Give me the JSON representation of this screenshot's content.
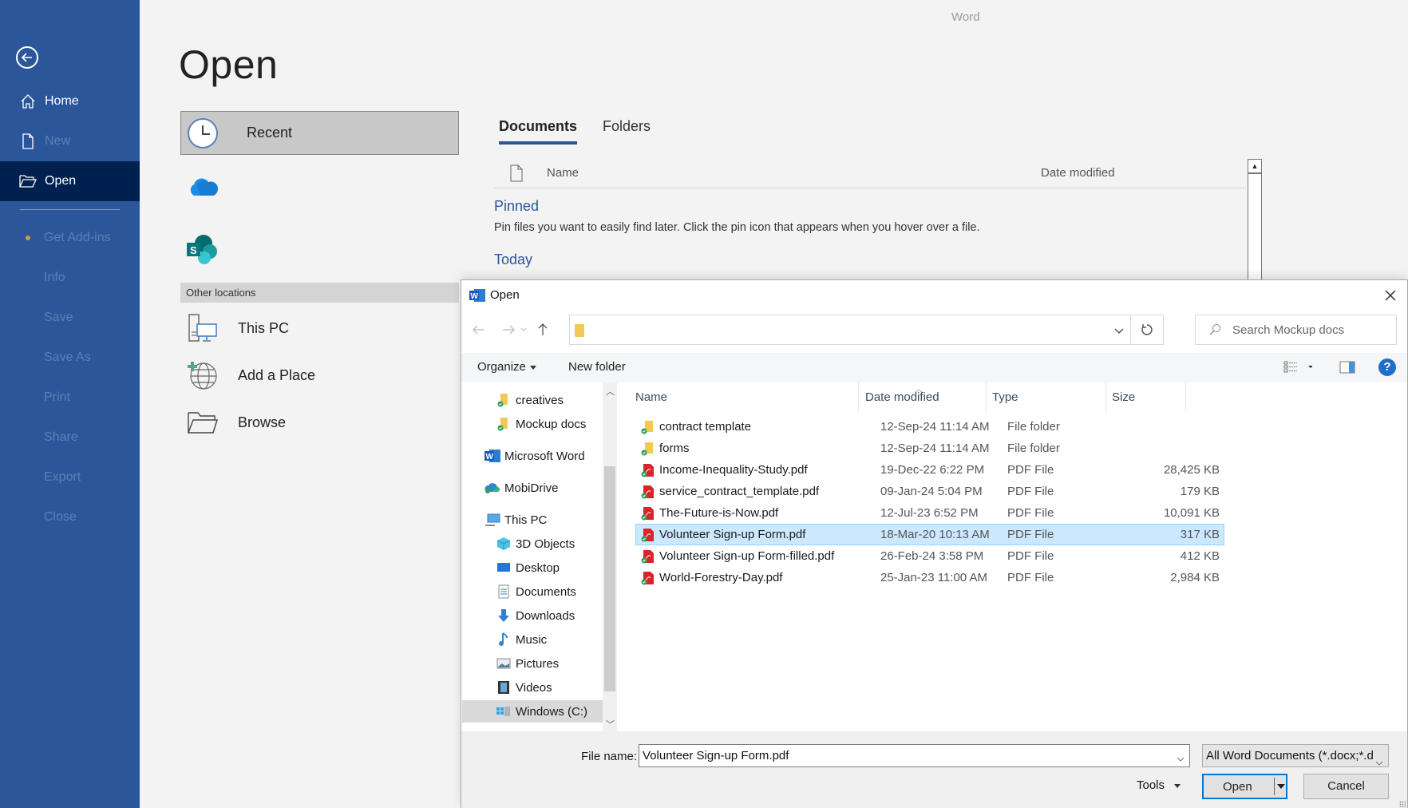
{
  "app": {
    "name": "Word"
  },
  "sidebar": {
    "back_label": "Back",
    "items": [
      {
        "label": "Home",
        "icon": "home-icon",
        "state": "normal"
      },
      {
        "label": "New",
        "icon": "new-document-icon",
        "state": "disabled"
      },
      {
        "label": "Open",
        "icon": "open-folder-icon",
        "state": "active"
      },
      {
        "label": "Get Add-ins",
        "state": "disabled"
      },
      {
        "label": "Info",
        "state": "disabled"
      },
      {
        "label": "Save",
        "state": "disabled"
      },
      {
        "label": "Save As",
        "state": "disabled"
      },
      {
        "label": "Print",
        "state": "disabled"
      },
      {
        "label": "Share",
        "state": "disabled"
      },
      {
        "label": "Export",
        "state": "disabled"
      },
      {
        "label": "Close",
        "state": "disabled"
      }
    ]
  },
  "backstage": {
    "title": "Open",
    "locations": {
      "recent_label": "Recent",
      "cloud_icon": "onedrive-icon",
      "sharepoint_icon": "sharepoint-icon",
      "other_header": "Other locations",
      "this_pc_label": "This PC",
      "add_place_label": "Add a Place",
      "browse_label": "Browse"
    },
    "tabs": [
      {
        "label": "Documents",
        "active": true
      },
      {
        "label": "Folders",
        "active": false
      }
    ],
    "columns": {
      "name": "Name",
      "date": "Date modified"
    },
    "pinned_title": "Pinned",
    "pinned_hint": "Pin files you want to easily find later. Click the pin icon that appears when you hover over a file.",
    "today_title": "Today"
  },
  "dialog": {
    "title": "Open",
    "address_path": "",
    "search_placeholder": "Search Mockup docs",
    "toolbar": {
      "organize_label": "Organize",
      "new_folder_label": "New folder"
    },
    "nav_tree": [
      {
        "label": "creatives",
        "icon": "folder-sync-icon",
        "indent": 2
      },
      {
        "label": "Mockup docs",
        "icon": "folder-sync-icon",
        "indent": 2
      },
      {
        "label": "Microsoft Word",
        "icon": "word-icon",
        "indent": 1
      },
      {
        "label": "MobiDrive",
        "icon": "cloud-drive-icon",
        "indent": 1
      },
      {
        "label": "This PC",
        "icon": "computer-icon",
        "indent": 1
      },
      {
        "label": "3D Objects",
        "icon": "cube-icon",
        "indent": 2
      },
      {
        "label": "Desktop",
        "icon": "desktop-icon",
        "indent": 2
      },
      {
        "label": "Documents",
        "icon": "documents-icon",
        "indent": 2
      },
      {
        "label": "Downloads",
        "icon": "download-icon",
        "indent": 2
      },
      {
        "label": "Music",
        "icon": "music-icon",
        "indent": 2
      },
      {
        "label": "Pictures",
        "icon": "pictures-icon",
        "indent": 2
      },
      {
        "label": "Videos",
        "icon": "videos-icon",
        "indent": 2
      },
      {
        "label": "Windows (C:)",
        "icon": "drive-icon",
        "indent": 2,
        "selected": true
      }
    ],
    "columns": {
      "name": "Name",
      "date": "Date modified",
      "type": "Type",
      "size": "Size"
    },
    "files": [
      {
        "name": "contract template",
        "date": "12-Sep-24 11:14 AM",
        "type": "File folder",
        "size": "",
        "kind": "folder"
      },
      {
        "name": "forms",
        "date": "12-Sep-24 11:14 AM",
        "type": "File folder",
        "size": "",
        "kind": "folder"
      },
      {
        "name": "Income-Inequality-Study.pdf",
        "date": "19-Dec-22 6:22 PM",
        "type": "PDF File",
        "size": "28,425 KB",
        "kind": "pdf"
      },
      {
        "name": "service_contract_template.pdf",
        "date": "09-Jan-24 5:04 PM",
        "type": "PDF File",
        "size": "179 KB",
        "kind": "pdf"
      },
      {
        "name": "The-Future-is-Now.pdf",
        "date": "12-Jul-23 6:52 PM",
        "type": "PDF File",
        "size": "10,091 KB",
        "kind": "pdf"
      },
      {
        "name": "Volunteer Sign-up Form.pdf",
        "date": "18-Mar-20 10:13 AM",
        "type": "PDF File",
        "size": "317 KB",
        "kind": "pdf",
        "selected": true
      },
      {
        "name": "Volunteer Sign-up Form-filled.pdf",
        "date": "26-Feb-24 3:58 PM",
        "type": "PDF File",
        "size": "412 KB",
        "kind": "pdf"
      },
      {
        "name": "World-Forestry-Day.pdf",
        "date": "25-Jan-23 11:00 AM",
        "type": "PDF File",
        "size": "2,984 KB",
        "kind": "pdf"
      }
    ],
    "file_name_label": "File name:",
    "file_name_value": "Volunteer Sign-up Form.pdf",
    "file_type_value": "All Word Documents (*.docx;*.d",
    "tools_label": "Tools",
    "open_label": "Open",
    "cancel_label": "Cancel"
  },
  "colors": {
    "accent": "#2b579a",
    "active_nav": "#002050",
    "selection": "#cce8ff",
    "primary_border": "#0078d7"
  }
}
